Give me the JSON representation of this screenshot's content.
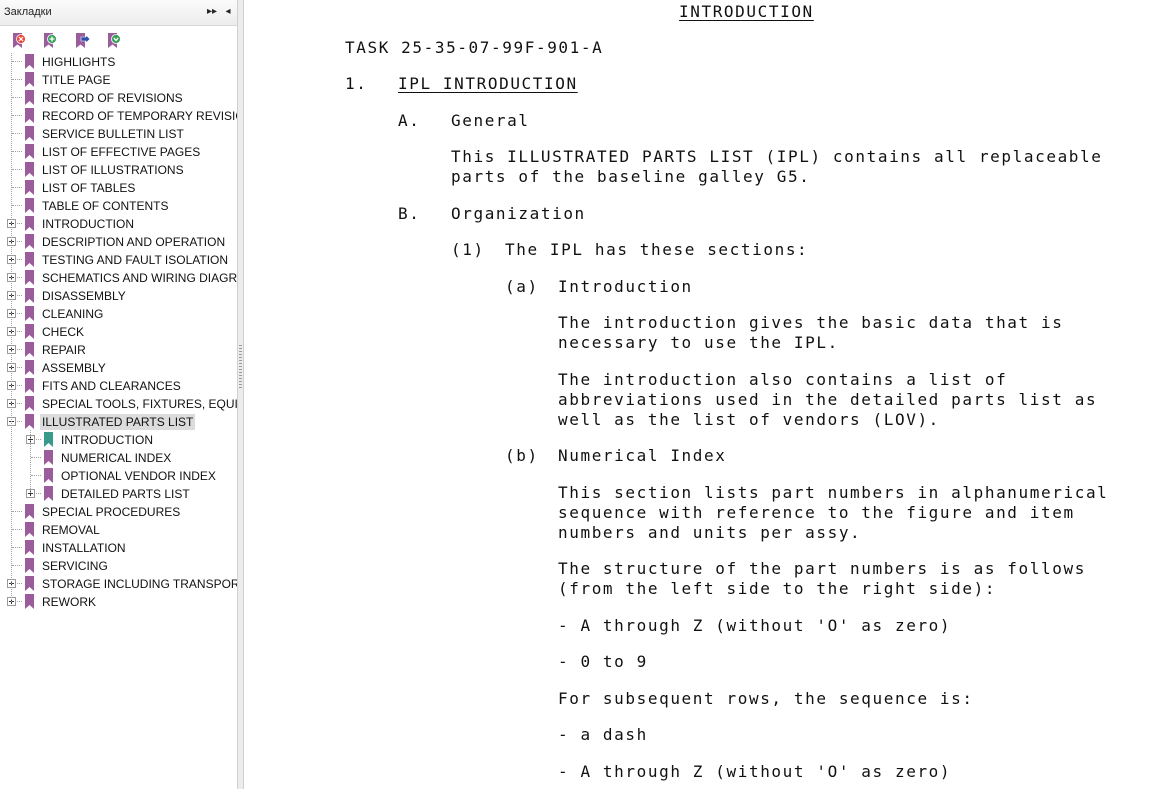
{
  "panel": {
    "title": "Закладки",
    "header_buttons": {
      "options": "▸▸",
      "collapse": "◂"
    },
    "toolbar": [
      {
        "name": "delete-bookmark",
        "tip": ""
      },
      {
        "name": "new-bookmark",
        "tip": ""
      },
      {
        "name": "go-to-bookmark",
        "tip": ""
      },
      {
        "name": "expand-bookmark",
        "tip": ""
      }
    ],
    "bookmarks": [
      {
        "label": "HIGHLIGHTS",
        "level": 0,
        "expandable": false
      },
      {
        "label": "TITLE PAGE",
        "level": 0,
        "expandable": false
      },
      {
        "label": "RECORD OF REVISIONS",
        "level": 0,
        "expandable": false
      },
      {
        "label": "RECORD OF TEMPORARY REVISIONS",
        "level": 0,
        "expandable": false
      },
      {
        "label": "SERVICE BULLETIN LIST",
        "level": 0,
        "expandable": false
      },
      {
        "label": "LIST OF EFFECTIVE PAGES",
        "level": 0,
        "expandable": false
      },
      {
        "label": "LIST OF ILLUSTRATIONS",
        "level": 0,
        "expandable": false
      },
      {
        "label": "LIST OF TABLES",
        "level": 0,
        "expandable": false
      },
      {
        "label": "TABLE OF CONTENTS",
        "level": 0,
        "expandable": false
      },
      {
        "label": "INTRODUCTION",
        "level": 0,
        "expandable": true,
        "expanded": false
      },
      {
        "label": "DESCRIPTION AND OPERATION",
        "level": 0,
        "expandable": true,
        "expanded": false
      },
      {
        "label": "TESTING AND FAULT ISOLATION",
        "level": 0,
        "expandable": true,
        "expanded": false
      },
      {
        "label": "SCHEMATICS AND WIRING DIAGRAMS",
        "level": 0,
        "expandable": true,
        "expanded": false
      },
      {
        "label": "DISASSEMBLY",
        "level": 0,
        "expandable": true,
        "expanded": false
      },
      {
        "label": "CLEANING",
        "level": 0,
        "expandable": true,
        "expanded": false
      },
      {
        "label": "CHECK",
        "level": 0,
        "expandable": true,
        "expanded": false
      },
      {
        "label": "REPAIR",
        "level": 0,
        "expandable": true,
        "expanded": false
      },
      {
        "label": "ASSEMBLY",
        "level": 0,
        "expandable": true,
        "expanded": false
      },
      {
        "label": "FITS AND CLEARANCES",
        "level": 0,
        "expandable": true,
        "expanded": false
      },
      {
        "label": "SPECIAL TOOLS, FIXTURES, EQUIPMENT",
        "level": 0,
        "expandable": true,
        "expanded": false
      },
      {
        "label": "ILLUSTRATED PARTS LIST",
        "level": 0,
        "expandable": true,
        "expanded": true,
        "selected": true
      },
      {
        "label": "INTRODUCTION",
        "level": 1,
        "expandable": true,
        "expanded": false,
        "current": true
      },
      {
        "label": "NUMERICAL INDEX",
        "level": 1,
        "expandable": false
      },
      {
        "label": "OPTIONAL VENDOR INDEX",
        "level": 1,
        "expandable": false
      },
      {
        "label": "DETAILED PARTS LIST",
        "level": 1,
        "expandable": true,
        "expanded": false
      },
      {
        "label": "SPECIAL PROCEDURES",
        "level": 0,
        "expandable": false
      },
      {
        "label": "REMOVAL",
        "level": 0,
        "expandable": false
      },
      {
        "label": "INSTALLATION",
        "level": 0,
        "expandable": false
      },
      {
        "label": "SERVICING",
        "level": 0,
        "expandable": false
      },
      {
        "label": "STORAGE INCLUDING TRANSPORTATION",
        "level": 0,
        "expandable": true,
        "expanded": false
      },
      {
        "label": "REWORK",
        "level": 0,
        "expandable": true,
        "expanded": false
      }
    ],
    "colors": {
      "bookmark": "#9b5c9b",
      "bookmark_current": "#3a9a8a"
    }
  },
  "document": {
    "header": "INTRODUCTION",
    "task": "TASK 25-35-07-99F-901-A",
    "sec1_num": "1.",
    "sec1_title": "IPL INTRODUCTION",
    "a_num": "A.",
    "a_title": "General",
    "a_text": "This ILLUSTRATED PARTS LIST (IPL) contains all replaceable\nparts of the baseline galley G5.",
    "b_num": "B.",
    "b_title": "Organization",
    "b1_num": "(1)",
    "b1_text": "The IPL has these sections:",
    "ba_num": "(a)",
    "ba_title": "Introduction",
    "ba_p1": "The introduction gives the basic data that is\nnecessary to use the IPL.",
    "ba_p2": "The introduction also contains a list of\nabbreviations used in the detailed parts list as\nwell as the list of vendors (LOV).",
    "bb_num": "(b)",
    "bb_title": "Numerical Index",
    "bb_p1": "This section lists part numbers in alphanumerical\nsequence with reference to the figure and item\nnumbers and units per assy.",
    "bb_p2": "The structure of the part numbers is as follows\n(from the left side to the right side):",
    "bb_l1": "- A through Z (without 'O' as zero)",
    "bb_l2": "- 0 to 9",
    "bb_p3": "For subsequent rows, the sequence is:",
    "bb_l3": "- a dash",
    "bb_l4": "- A through Z (without 'O' as zero)"
  }
}
